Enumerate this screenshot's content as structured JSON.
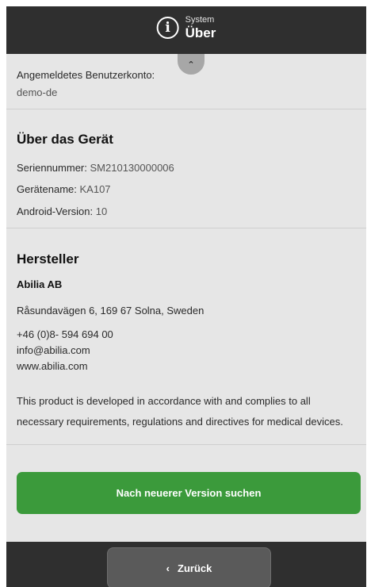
{
  "header": {
    "section": "System",
    "title": "Über"
  },
  "account": {
    "label": "Angemeldetes Benutzerkonto:",
    "value": "demo-de"
  },
  "device": {
    "heading": "Über das Gerät",
    "serial_label": "Seriennummer:",
    "serial_value": "SM210130000006",
    "name_label": "Gerätename:",
    "name_value": "KA107",
    "android_label": "Android-Version:",
    "android_value": "10"
  },
  "manufacturer": {
    "heading": "Hersteller",
    "name": "Abilia AB",
    "address": "Råsundavägen 6, 169 67 Solna, Sweden",
    "phone": "+46 (0)8- 594 694 00",
    "email": "info@abilia.com",
    "web": "www.abilia.com",
    "compliance_line1": "This product is developed in accordance with and complies to all",
    "compliance_line2": "necessary requirements, regulations and directives for medical devices."
  },
  "actions": {
    "check_update": "Nach neuerer Version suchen",
    "back": "Zurück"
  },
  "icons": {
    "header": "info-icon",
    "scroll": "chevron-up-icon",
    "back": "chevron-left-icon"
  },
  "colors": {
    "topbar": "#2f2f2f",
    "content_bg": "#e6e6e6",
    "accent_green": "#3b9a3b"
  }
}
